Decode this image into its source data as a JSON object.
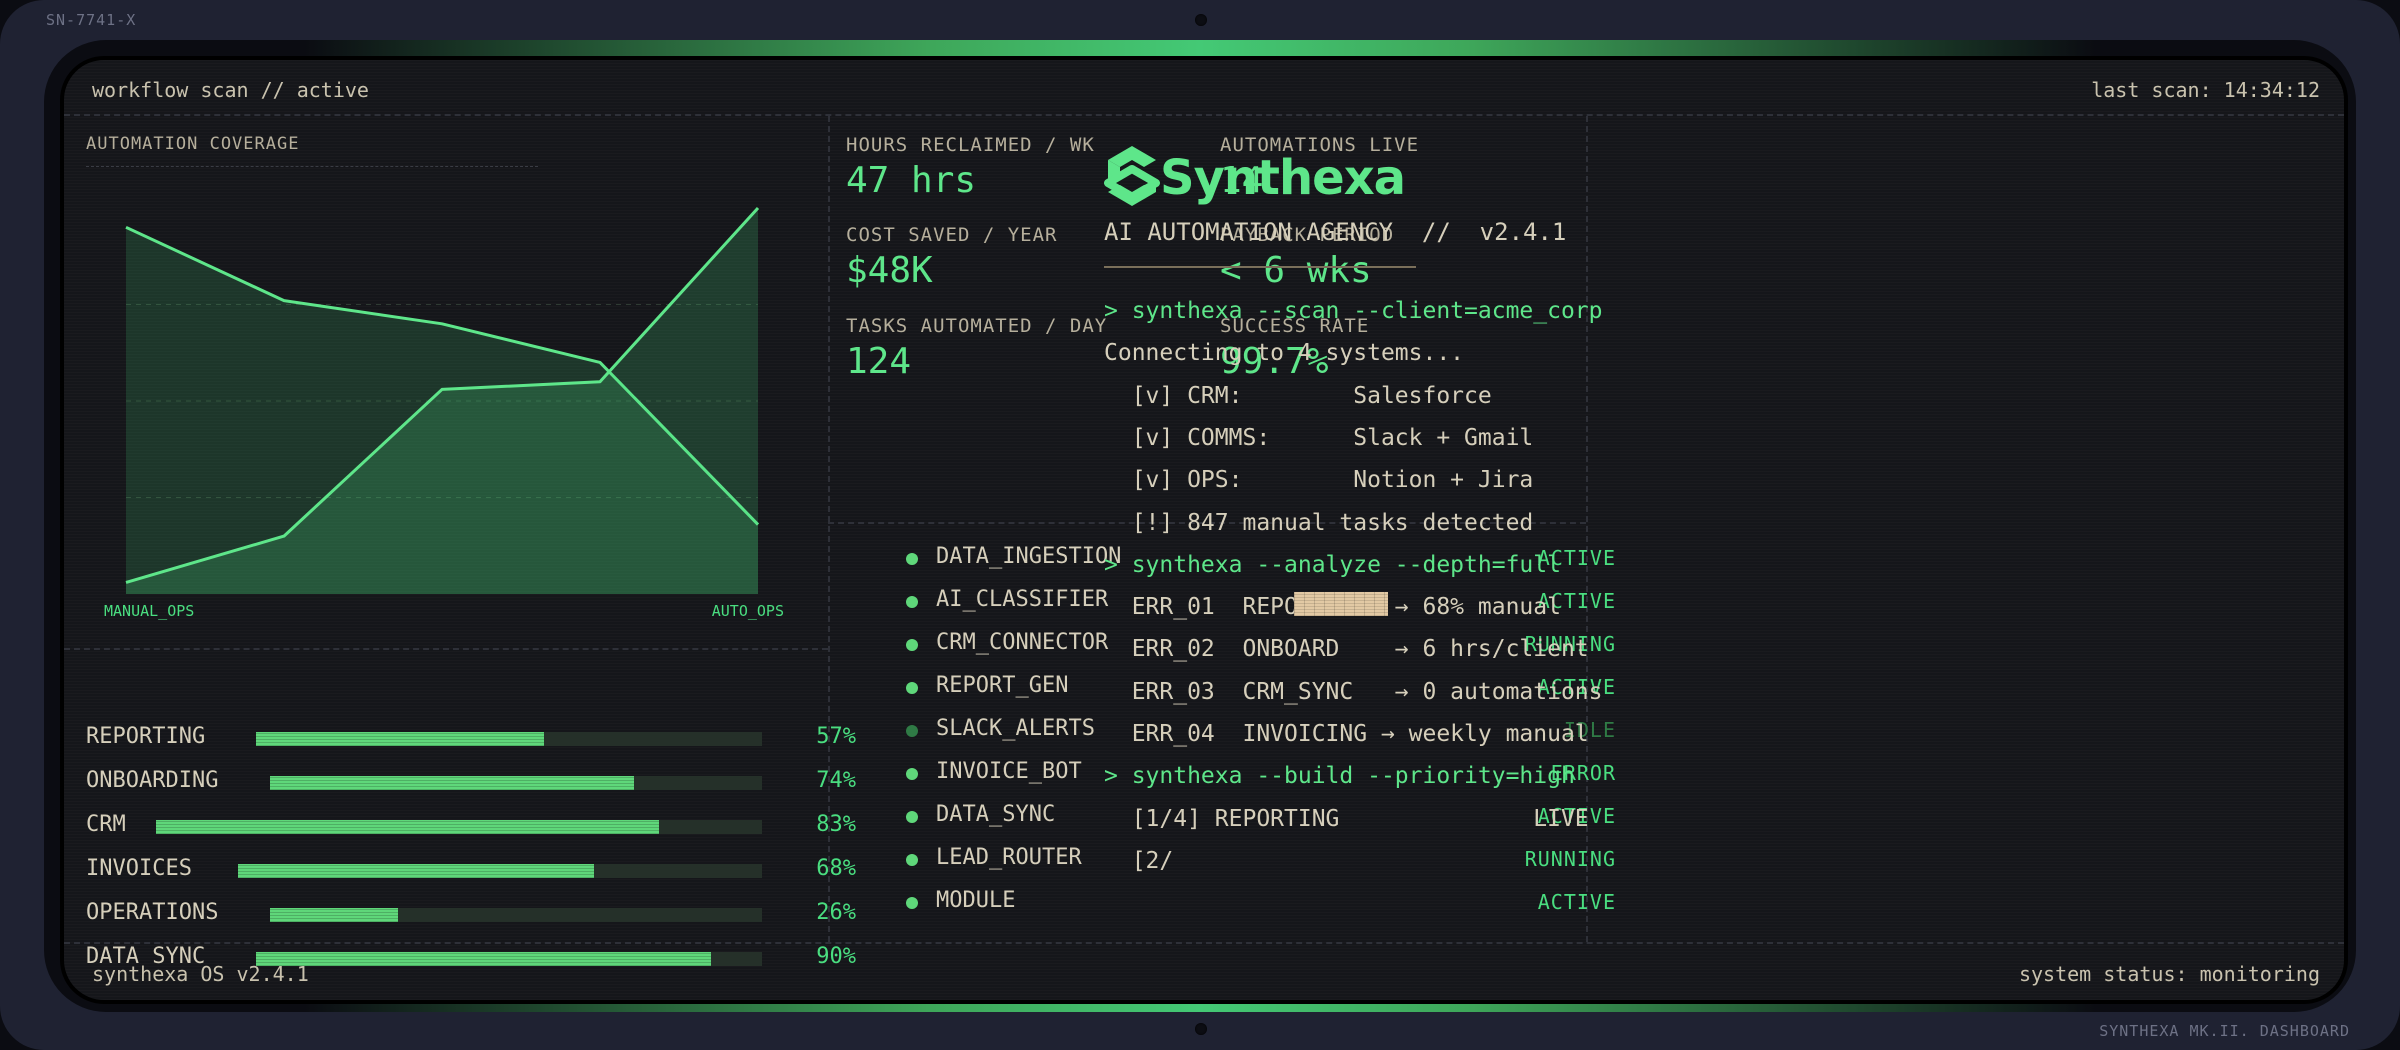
{
  "device": {
    "serial": "SN-7741-X",
    "brand": "SYNTHEXA MK.II. DASHBOARD"
  },
  "topbar": {
    "left": "workflow scan // active",
    "right": "last scan: 14:34:12"
  },
  "footer": {
    "left": "synthexa OS v2.4.1",
    "right": "system status: monitoring"
  },
  "chart_data": {
    "type": "area",
    "title": "AUTOMATION COVERAGE",
    "x": [
      0,
      1,
      2,
      3,
      4
    ],
    "series": [
      {
        "name": "MANUAL_OPS",
        "values": [
          95,
          76,
          70,
          60,
          18
        ],
        "color": "#5ee68a"
      },
      {
        "name": "AUTO_OPS",
        "values": [
          3,
          15,
          53,
          55,
          100
        ],
        "color": "#5ee68a"
      }
    ],
    "ylim": [
      0,
      100
    ],
    "grid": true,
    "legend": "bottom"
  },
  "coverage_bars": [
    {
      "label": "REPORTING",
      "pct": 57,
      "pct_text": "57%"
    },
    {
      "label": "ONBOARDING",
      "pct": 74,
      "pct_text": "74%"
    },
    {
      "label": "CRM",
      "pct": 83,
      "pct_text": "83%"
    },
    {
      "label": "INVOICES",
      "pct": 68,
      "pct_text": "68%"
    },
    {
      "label": "OPERATIONS",
      "pct": 26,
      "pct_text": "26%"
    },
    {
      "label": "DATA SYNC",
      "pct": 90,
      "pct_text": "90%"
    }
  ],
  "metrics": [
    {
      "label": "HOURS RECLAIMED / WK",
      "value": "47 hrs"
    },
    {
      "label": "AUTOMATIONS LIVE",
      "value": "14"
    },
    {
      "label": "COST SAVED / YEAR",
      "value": "$48K"
    },
    {
      "label": "PAYBACK PERIOD",
      "value": "< 6 wks"
    },
    {
      "label": "TASKS AUTOMATED / DAY",
      "value": "124"
    },
    {
      "label": "SUCCESS RATE",
      "value": "99.7%"
    }
  ],
  "processes": [
    {
      "name": "DATA_INGESTION",
      "status": "ACTIVE"
    },
    {
      "name": "AI_CLASSIFIER",
      "status": "ACTIVE"
    },
    {
      "name": "CRM_CONNECTOR",
      "status": "RUNNING"
    },
    {
      "name": "REPORT_GEN",
      "status": "ACTIVE"
    },
    {
      "name": "SLACK_ALERTS",
      "status": "IDLE"
    },
    {
      "name": "INVOICE_BOT",
      "status": "ERROR"
    },
    {
      "name": "DATA_SYNC",
      "status": "ACTIVE"
    },
    {
      "name": "LEAD_ROUTER",
      "status": "RUNNING"
    },
    {
      "name": "MODULE",
      "status": "ACTIVE"
    }
  ],
  "terminal": {
    "logo_text": "Synthexa",
    "tagline": "AI AUTOMATION AGENCY  //  v2.4.1",
    "lines": [
      {
        "text": "> synthexa --scan --client=acme_corp",
        "cmd": true
      },
      {
        "text": "Connecting to 4 systems...",
        "cmd": false
      },
      {
        "text": "  [v] CRM:        Salesforce",
        "cmd": false
      },
      {
        "text": "  [v] COMMS:      Slack + Gmail",
        "cmd": false
      },
      {
        "text": "  [v] OPS:        Notion + Jira",
        "cmd": false
      },
      {
        "text": "  [!] 847 manual tasks detected",
        "cmd": false
      },
      {
        "text": "> synthexa --analyze --depth=full",
        "cmd": true
      },
      {
        "text": "  ERR_01  REPORTING  → 68% manual",
        "cmd": false
      },
      {
        "text": "  ERR_02  ONBOARD    → 6 hrs/client",
        "cmd": false
      },
      {
        "text": "  ERR_03  CRM_SYNC   → 0 automations",
        "cmd": false
      },
      {
        "text": "  ERR_04  INVOICING → weekly manual",
        "cmd": false
      },
      {
        "text": "> synthexa --build --priority=high",
        "cmd": true
      },
      {
        "text": "  [1/4] REPORTING              LIVE",
        "cmd": false
      },
      {
        "text": "  [2/",
        "cmd": false
      }
    ]
  }
}
